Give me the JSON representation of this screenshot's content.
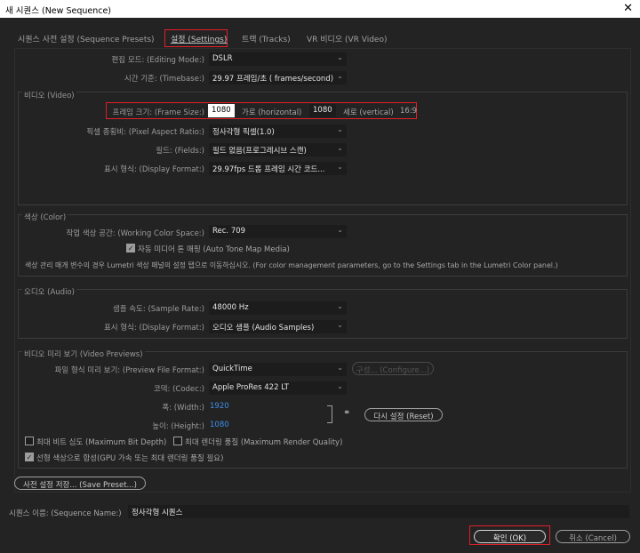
{
  "window": {
    "title": "새 시퀀스 (New Sequence)",
    "close": "✕"
  },
  "tabs": [
    {
      "label": "시퀀스 사전 설정 (Sequence Presets)"
    },
    {
      "label": "설정 (Settings)"
    },
    {
      "label": "트랙 (Tracks)"
    },
    {
      "label": "VR 비디오 (VR Video)"
    }
  ],
  "general": {
    "editing_mode_label": "편집 모드: (Editing Mode:)",
    "editing_mode_value": "DSLR",
    "timebase_label": "시간 기준: (Timebase:)",
    "timebase_value": "29.97 프레임/초 ( frames/second)"
  },
  "video": {
    "title": "비디오 (Video)",
    "frame_size_label": "프레임 크기: (Frame Size:)",
    "frame_width": "1080",
    "horizontal_label": "가로 (horizontal)",
    "frame_height": "1080",
    "vertical_label": "세로 (vertical)",
    "aspect": "16:9",
    "pixel_aspect_label": "픽셀 종횡비: (Pixel Aspect Ratio:)",
    "pixel_aspect_value": "정사각형 픽셀(1.0)",
    "fields_label": "필드: (Fields:)",
    "fields_value": "필드 없음(프로그레시브 스캔)",
    "display_format_label": "표시 형식: (Display Format:)",
    "display_format_value": "29.97fps 드롭 프레임 시간 코드..."
  },
  "color": {
    "title": "색상 (Color)",
    "working_space_label": "작업 색상 공간: (Working Color Space:)",
    "working_space_value": "Rec. 709",
    "auto_tone_label": "자동 미디어 톤 매핑 (Auto Tone Map Media)",
    "auto_tone_checked": true,
    "note": "색상 관리 매개 변수의 경우 Lumetri 색상 패널의 설정 탭으로 이동하십시오. (For color management parameters, go to the Settings tab in the Lumetri Color panel.)"
  },
  "audio": {
    "title": "오디오 (Audio)",
    "sample_rate_label": "샘플 속도: (Sample Rate:)",
    "sample_rate_value": "48000 Hz",
    "display_format_label": "표시 형식: (Display Format:)",
    "display_format_value": "오디오 샘플 (Audio Samples)"
  },
  "previews": {
    "title": "비디오 미리 보기 (Video Previews)",
    "file_format_label": "파일 형식 미리 보기: (Preview File Format:)",
    "file_format_value": "QuickTime",
    "configure_label": "구성... (Configure...)",
    "codec_label": "코덱: (Codec:)",
    "codec_value": "Apple ProRes 422 LT",
    "width_label": "폭: (Width:)",
    "width_value": "1920",
    "height_label": "높이: (Height:)",
    "height_value": "1080",
    "reset_label": "다시 설정 (Reset)",
    "max_bit_depth_label": "최대 비트 심도 (Maximum Bit Depth)",
    "max_bit_depth_checked": false,
    "max_render_label": "최대 렌더링 품질 (Maximum Render Quality)",
    "max_render_checked": false,
    "linear_color_label": "선형 색상으로 합성(GPU 가속 또는 최대 렌더링 품질 필요)",
    "linear_color_checked": true
  },
  "save_preset_label": "사전 설정 저장... (Save Preset...)",
  "sequence_name_label": "시퀀스 이름: (Sequence Name:)",
  "sequence_name_value": "정사각형 시퀀스",
  "ok_label": "확인 (OK)",
  "cancel_label": "취소 (Cancel)",
  "colors": {
    "background": "#232323",
    "highlight_box": "#e0202a",
    "link_value": "#3d8fe8"
  }
}
